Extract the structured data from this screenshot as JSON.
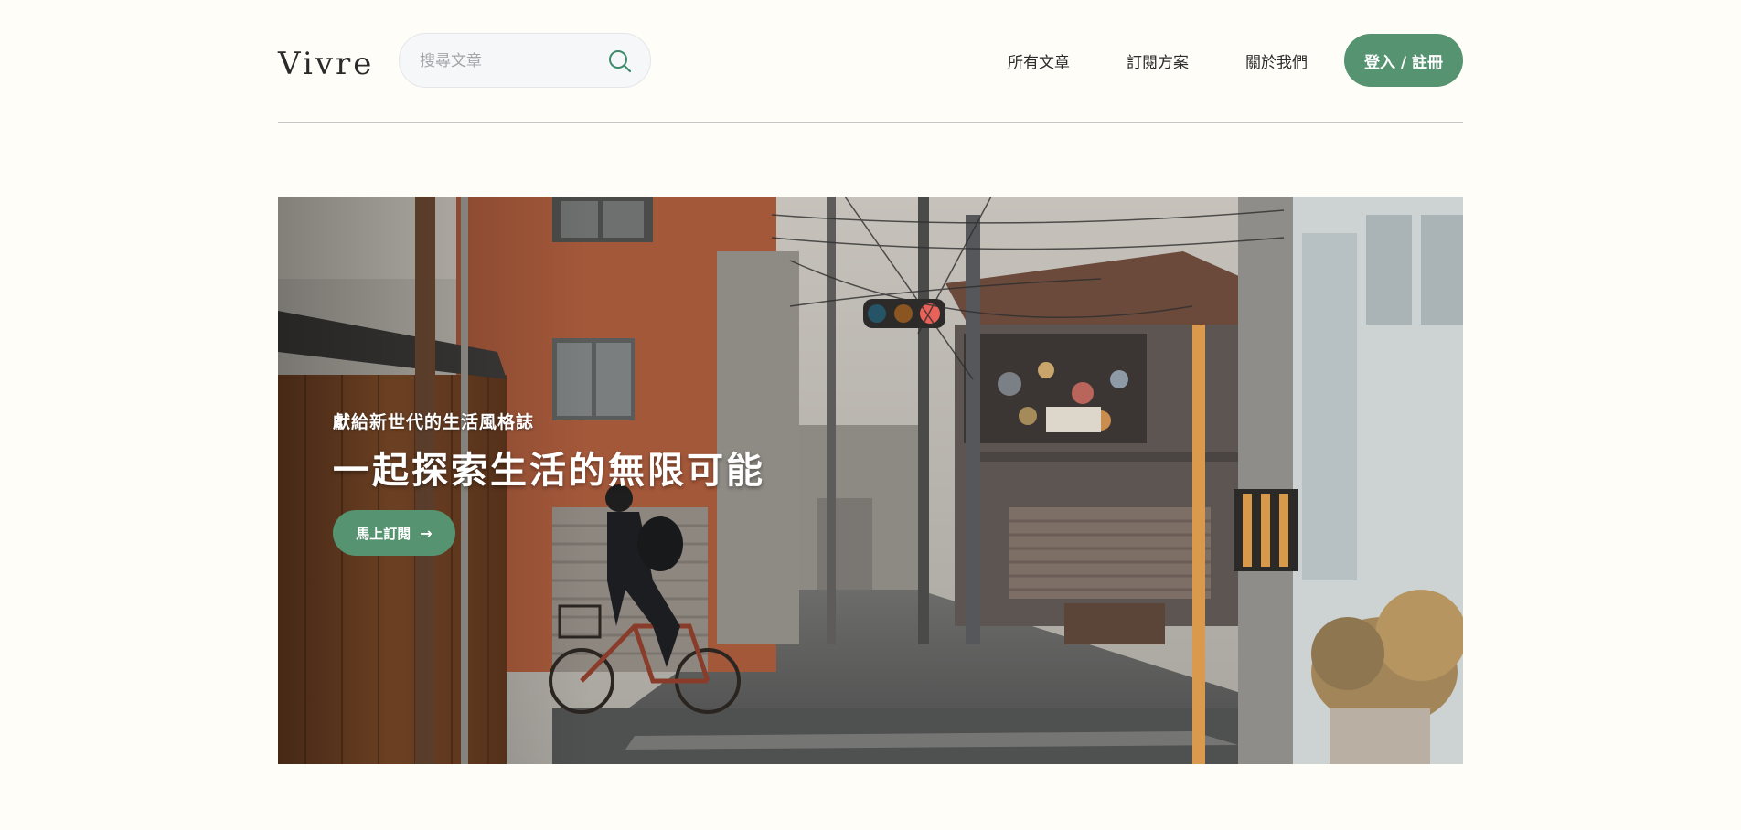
{
  "header": {
    "logo": "Vivre",
    "search": {
      "placeholder": "搜尋文章",
      "icon": "search-icon"
    },
    "nav": [
      {
        "label": "所有文章"
      },
      {
        "label": "訂閱方案"
      },
      {
        "label": "關於我們"
      }
    ],
    "login_label": "登入 / 註冊"
  },
  "hero": {
    "subtitle": "獻給新世代的生活風格誌",
    "title": "一起探索生活的無限可能",
    "cta_label": "馬上訂閱",
    "cta_icon": "arrow-right-icon",
    "image": "street-scene-photo"
  },
  "colors": {
    "background": "#FEFDF7",
    "accent": "#559371",
    "search_bg": "#F6F7F9",
    "divider": "#C5C5C3"
  }
}
